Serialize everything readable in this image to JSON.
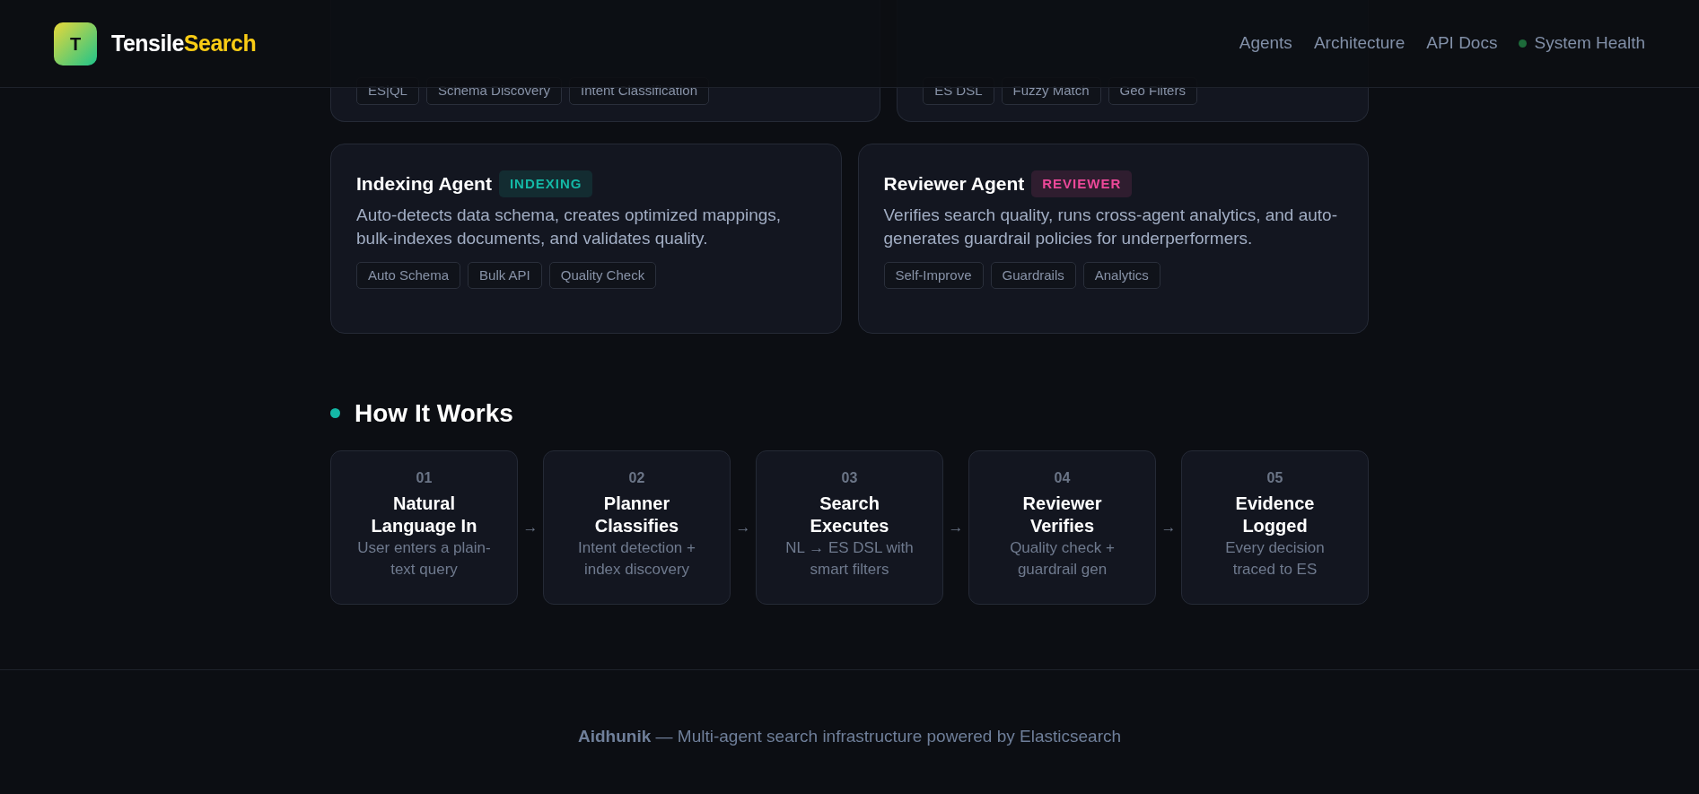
{
  "header": {
    "logo_letter": "T",
    "brand_first": "Tensile",
    "brand_second": "Search",
    "nav": [
      {
        "label": "Agents",
        "kind": "link"
      },
      {
        "label": "Architecture",
        "kind": "link"
      },
      {
        "label": "API Docs",
        "kind": "link"
      },
      {
        "label": "System Health",
        "kind": "status"
      }
    ]
  },
  "cut_off_cards": [
    {
      "tags": [
        "ES|QL",
        "Schema Discovery",
        "Intent Classification"
      ]
    },
    {
      "tags": [
        "ES DSL",
        "Fuzzy Match",
        "Geo Filters"
      ]
    }
  ],
  "agents": [
    {
      "name": "Indexing Agent",
      "badge": "INDEXING",
      "color": "#14b8a6",
      "description": "Auto-detects data schema, creates optimized mappings, bulk-indexes documents, and validates quality.",
      "tags": [
        "Auto Schema",
        "Bulk API",
        "Quality Check"
      ]
    },
    {
      "name": "Reviewer Agent",
      "badge": "REVIEWER",
      "color": "#ec4899",
      "description": "Verifies search quality, runs cross-agent analytics, and auto-generates guardrail policies for underperformers.",
      "tags": [
        "Self-Improve",
        "Guardrails",
        "Analytics"
      ]
    }
  ],
  "how_it_works": {
    "title": "How It Works",
    "steps": [
      {
        "number": "01",
        "title": "Natural Language In",
        "description": "User enters a plain-text query"
      },
      {
        "number": "02",
        "title": "Planner Classifies",
        "description": "Intent detection + index discovery"
      },
      {
        "number": "03",
        "title": "Search Executes",
        "description": "NL → ES DSL with smart filters"
      },
      {
        "number": "04",
        "title": "Reviewer Verifies",
        "description": "Quality check + guardrail gen"
      },
      {
        "number": "05",
        "title": "Evidence Logged",
        "description": "Every decision traced to ES"
      }
    ],
    "arrows": [
      "→",
      "→",
      "→",
      "→"
    ]
  },
  "footer": {
    "text": "**Aidhunik** — Multi-agent search infrastructure powered by Elasticsearch"
  }
}
